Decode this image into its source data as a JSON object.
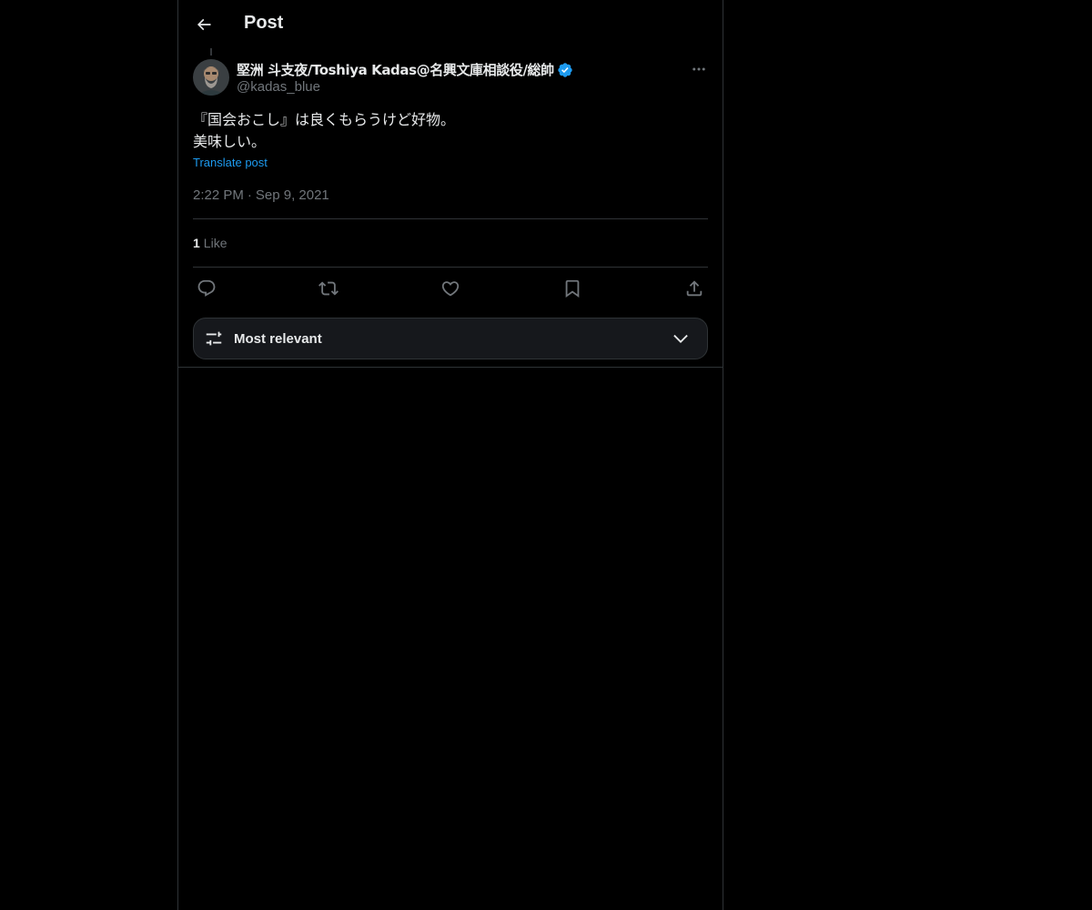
{
  "header": {
    "title": "Post",
    "back_icon": "arrow-left-icon"
  },
  "post": {
    "author_name": "堅洲 斗支夜/Toshiya Kadas@名興文庫相談役/総帥",
    "verified": true,
    "handle": "@kadas_blue",
    "text_line1": "『国会おこし』は良くもらうけど好物。",
    "text_line2": "美味しい。",
    "translate_label": "Translate post",
    "time": "2:22 PM",
    "separator": "·",
    "date": "Sep 9, 2021",
    "like_count": "1",
    "like_label": "Like"
  },
  "actions": [
    {
      "name": "reply",
      "icon": "reply-icon"
    },
    {
      "name": "repost",
      "icon": "repost-icon"
    },
    {
      "name": "like",
      "icon": "heart-icon"
    },
    {
      "name": "bookmark",
      "icon": "bookmark-icon"
    },
    {
      "name": "share",
      "icon": "share-icon"
    }
  ],
  "sort": {
    "label": "Most relevant"
  },
  "colors": {
    "background": "#000000",
    "text": "#e7e9ea",
    "muted": "#71767b",
    "accent": "#1d9bf0",
    "border": "#2f3336"
  }
}
